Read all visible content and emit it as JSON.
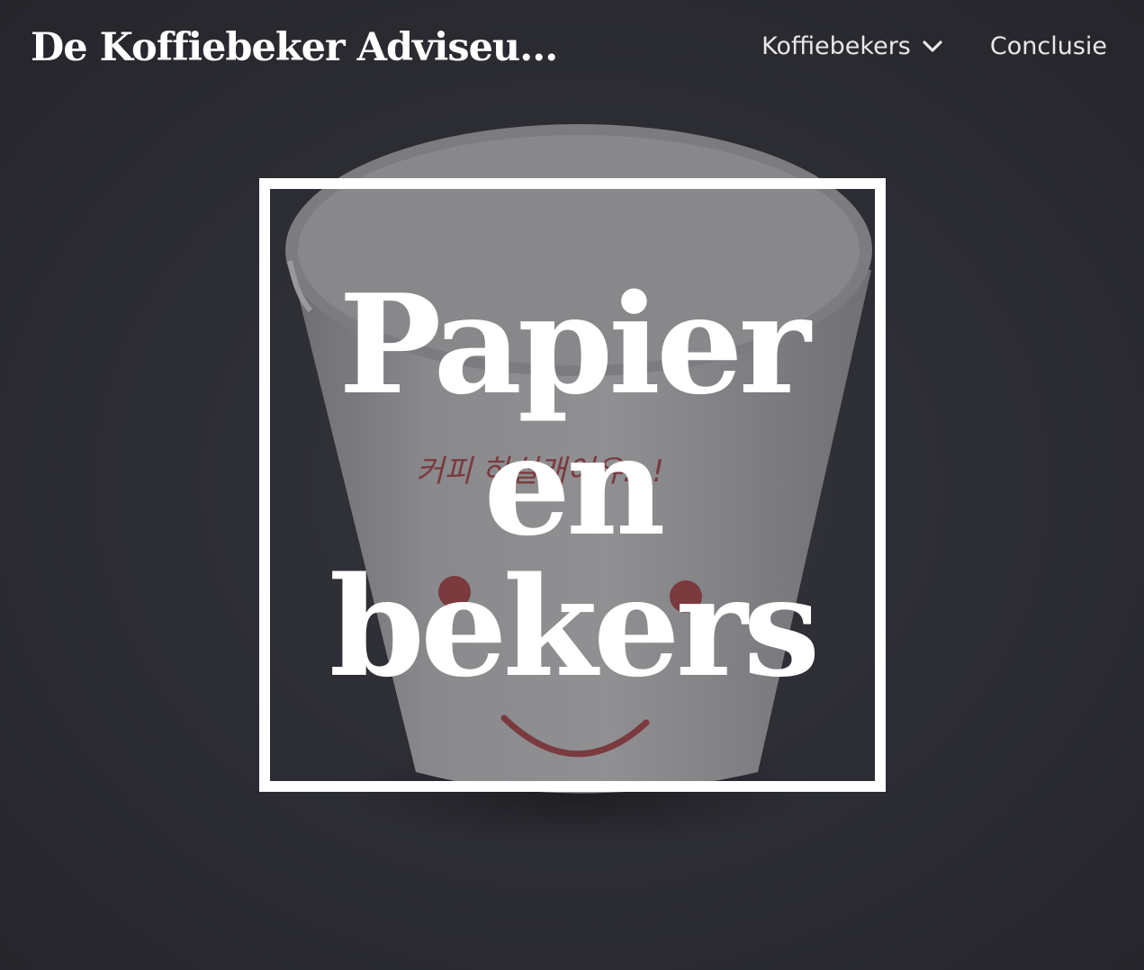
{
  "header": {
    "site_title": "De Koffiebeker Adviseu…",
    "nav": [
      {
        "label": "Koffiebekers",
        "has_dropdown": true,
        "icon": "chevron-down-icon"
      },
      {
        "label": "Conclusie",
        "has_dropdown": false
      }
    ]
  },
  "hero": {
    "title_lines": [
      "Papier",
      "en",
      "bekers"
    ],
    "background_image": "photo of a white paper cup with red smiley face and Korean text on dark background",
    "cup_print_text": "커피 하실래여유...!",
    "overlay_color": "#2b2b32",
    "frame_color": "#ffffff"
  }
}
